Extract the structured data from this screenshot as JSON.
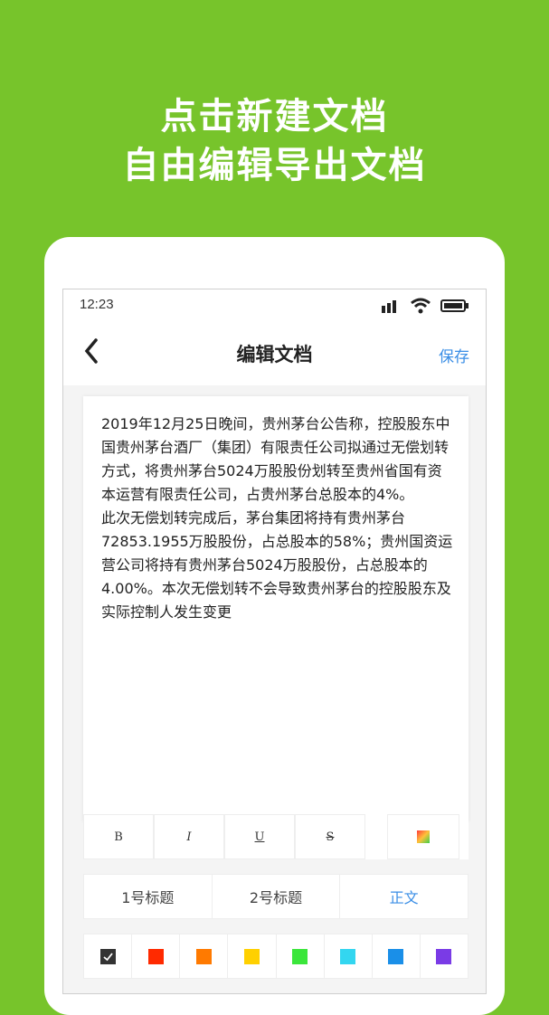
{
  "headline": {
    "line1": "点击新建文档",
    "line2": "自由编辑导出文档"
  },
  "statusbar": {
    "time": "12:23",
    "icons": [
      "signal-icon",
      "wifi-icon",
      "battery-icon"
    ]
  },
  "navbar": {
    "back_icon": "chevron-left-icon",
    "title": "编辑文档",
    "save_label": "保存"
  },
  "document": {
    "paragraph1": "2019年12月25日晚间，贵州茅台公告称，控股股东中国贵州茅台酒厂（集团）有限责任公司拟通过无偿划转方式，将贵州茅台5024万股股份划转至贵州省国有资本运营有限责任公司，占贵州茅台总股本的4%。",
    "paragraph2": "此次无偿划转完成后，茅台集团将持有贵州茅台72853.1955万股股份，占总股本的58%；贵州国资运营公司将持有贵州茅台5024万股股份，占总股本的4.00%。本次无偿划转不会导致贵州茅台的控股股东及实际控制人发生变更"
  },
  "format_toolbar": {
    "bold": "B",
    "italic": "I",
    "underline": "U",
    "strike": "S"
  },
  "heading_toolbar": {
    "h1": "1号标题",
    "h2": "2号标题",
    "body": "正文"
  },
  "colors": {
    "accent": "#77c42b",
    "link": "#3a8ee6",
    "palette": [
      "#333333",
      "#ff2a00",
      "#ff7a00",
      "#ffd000",
      "#3be63b",
      "#33d6f0",
      "#1a8fe8",
      "#7a3be6"
    ]
  }
}
